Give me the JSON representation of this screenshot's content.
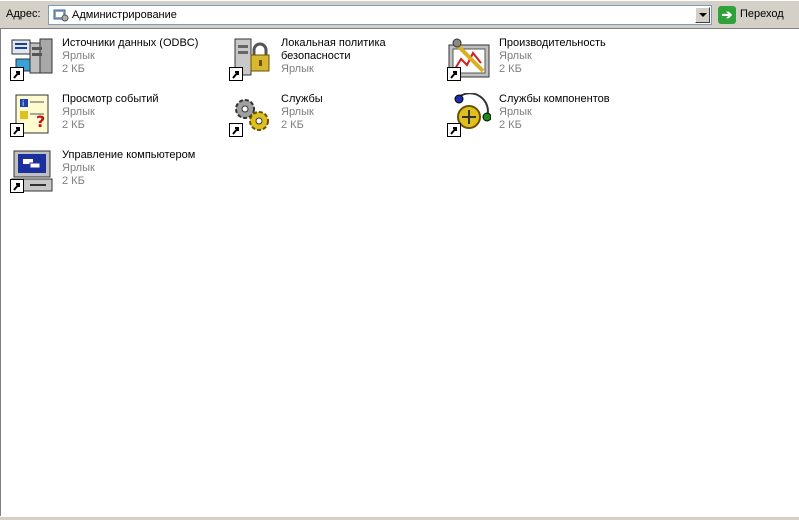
{
  "address_bar": {
    "label": "Адрес:",
    "value": "Администрирование",
    "go_label": "Переход"
  },
  "items": [
    {
      "name": "Источники данных (ODBC)",
      "type": "Ярлык",
      "size": "2 КБ",
      "icon": "odbc-data-sources-icon"
    },
    {
      "name": "Локальная политика безопасности",
      "type": "Ярлык",
      "size": "",
      "icon": "local-security-policy-icon"
    },
    {
      "name": "Производительность",
      "type": "Ярлык",
      "size": "2 КБ",
      "icon": "performance-icon"
    },
    {
      "name": "Просмотр событий",
      "type": "Ярлык",
      "size": "2 КБ",
      "icon": "event-viewer-icon"
    },
    {
      "name": "Службы",
      "type": "Ярлык",
      "size": "2 КБ",
      "icon": "services-icon"
    },
    {
      "name": "Службы компонентов",
      "type": "Ярлык",
      "size": "2 КБ",
      "icon": "component-services-icon"
    },
    {
      "name": "Управление компьютером",
      "type": "Ярлык",
      "size": "2 КБ",
      "icon": "computer-management-icon"
    }
  ]
}
